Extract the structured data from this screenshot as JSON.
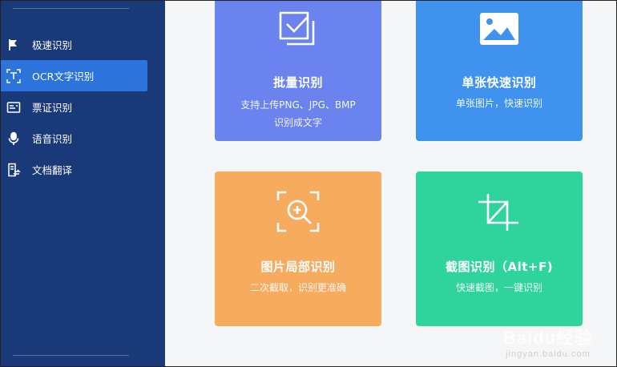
{
  "sidebar": {
    "items": [
      {
        "label": "极速识别",
        "icon": "flag-icon"
      },
      {
        "label": "OCR文字识别",
        "icon": "text-scan-icon"
      },
      {
        "label": "票证识别",
        "icon": "id-card-icon"
      },
      {
        "label": "语音识别",
        "icon": "microphone-icon"
      },
      {
        "label": "文档翻译",
        "icon": "document-translate-icon"
      }
    ],
    "active_index": 1
  },
  "cards": {
    "batch": {
      "title": "批量识别",
      "desc_line1": "支持上传PNG、JPG、BMP",
      "desc_line2": "识别成文字",
      "icon": "batch-upload-icon",
      "color": "#6a83ef"
    },
    "single": {
      "title": "单张快速识别",
      "desc": "单张图片，快速识别",
      "icon": "image-icon",
      "color": "#3f93ee"
    },
    "partial": {
      "title": "图片局部识别",
      "desc": "二次截取，识别更准确",
      "icon": "zoom-in-icon",
      "color": "#f6ab5e"
    },
    "screenshot": {
      "title": "截图识别（Alt+F)",
      "desc": "快速截图，一键识别",
      "icon": "crop-icon",
      "color": "#2ed49c"
    }
  },
  "watermark": {
    "line1": "Baidu经验",
    "line2": "jingyan.baidu.com"
  },
  "colors": {
    "sidebar_bg": "#1a3978",
    "active_bg": "#2d73dc",
    "main_bg": "#f5f6f8"
  }
}
